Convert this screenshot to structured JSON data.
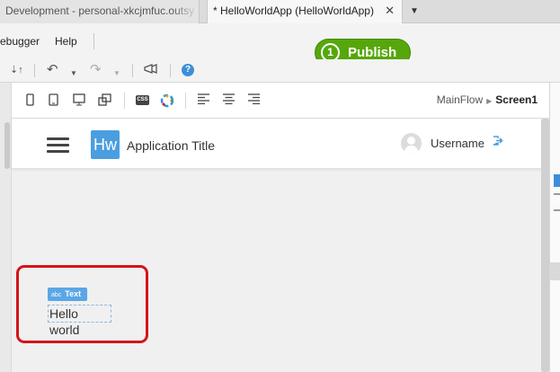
{
  "tabs": [
    {
      "label": "Development - personal-xkcjmfuc.outsy",
      "active": false
    },
    {
      "label": "* HelloWorldApp (HelloWorldApp)",
      "active": true
    }
  ],
  "menu": {
    "items": [
      "ebugger",
      "Help"
    ]
  },
  "publish": {
    "step": "1",
    "label": "Publish",
    "color": "#56a70b"
  },
  "toolbar": {
    "icons": [
      "merge-down-icon",
      "undo-icon",
      "redo-icon",
      "megaphone-icon",
      "help-icon"
    ],
    "help_label": "?"
  },
  "canvas_toolbar": {
    "icons": [
      "phone-icon",
      "tablet-icon",
      "desktop-icon",
      "multi-screen-icon",
      "css-icon",
      "theme-icon",
      "align-left-icon",
      "align-center-icon",
      "align-right-icon"
    ],
    "css_label": "CSS"
  },
  "breadcrumb": {
    "flow": "MainFlow",
    "screen": "Screen1"
  },
  "app": {
    "logo_text": "Hw",
    "title": "Application Title",
    "username": "Username",
    "accent": "#4a9ee0"
  },
  "widget": {
    "badge_prefix": "abc",
    "badge_label": "Text",
    "text": "Hello world"
  }
}
